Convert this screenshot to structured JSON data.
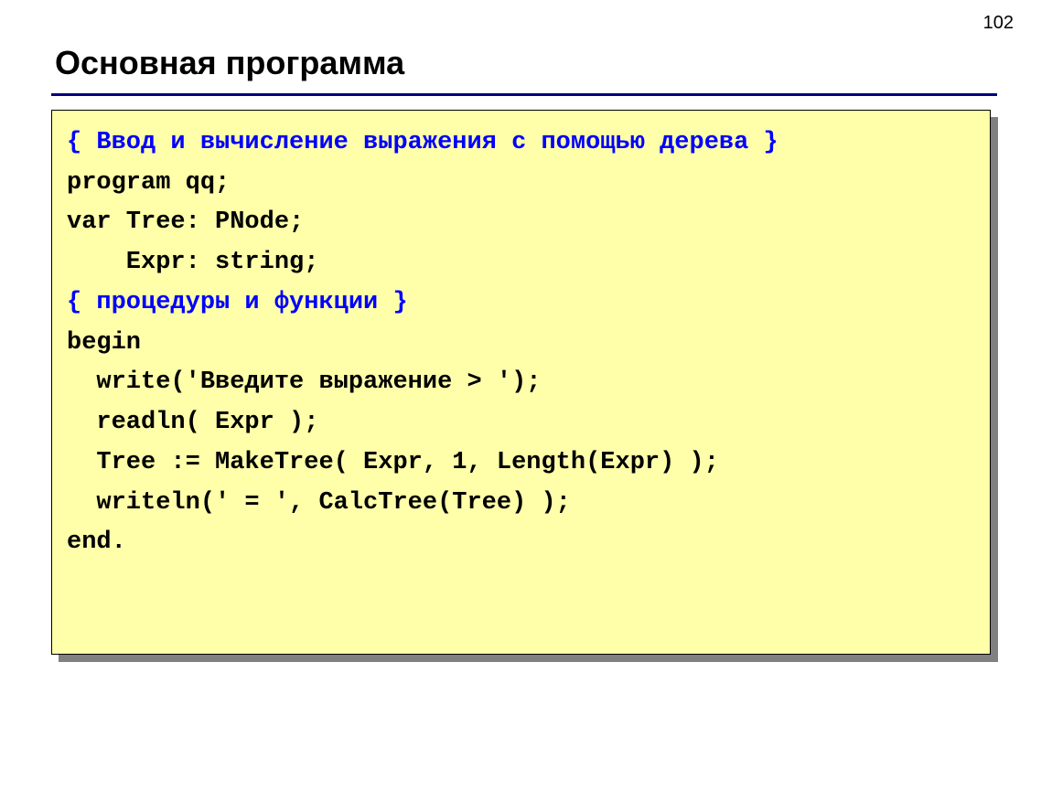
{
  "page_number": "102",
  "title": "Основная программа",
  "code": {
    "c1": "{ Ввод и вычисление выражения с помощью дерева }",
    "l1": "program qq;",
    "l2": "var Tree: PNode;",
    "l3": "    Expr: string;",
    "c2": "{ процедуры и функции }",
    "l4": "begin",
    "l5": "  write('Введите выражение > ');",
    "l6": "  readln( Expr );",
    "l7": "  Tree := MakeTree( Expr, 1, Length(Expr) );",
    "l8": "  writeln(' = ', CalcTree(Tree) );",
    "l9": "end."
  }
}
